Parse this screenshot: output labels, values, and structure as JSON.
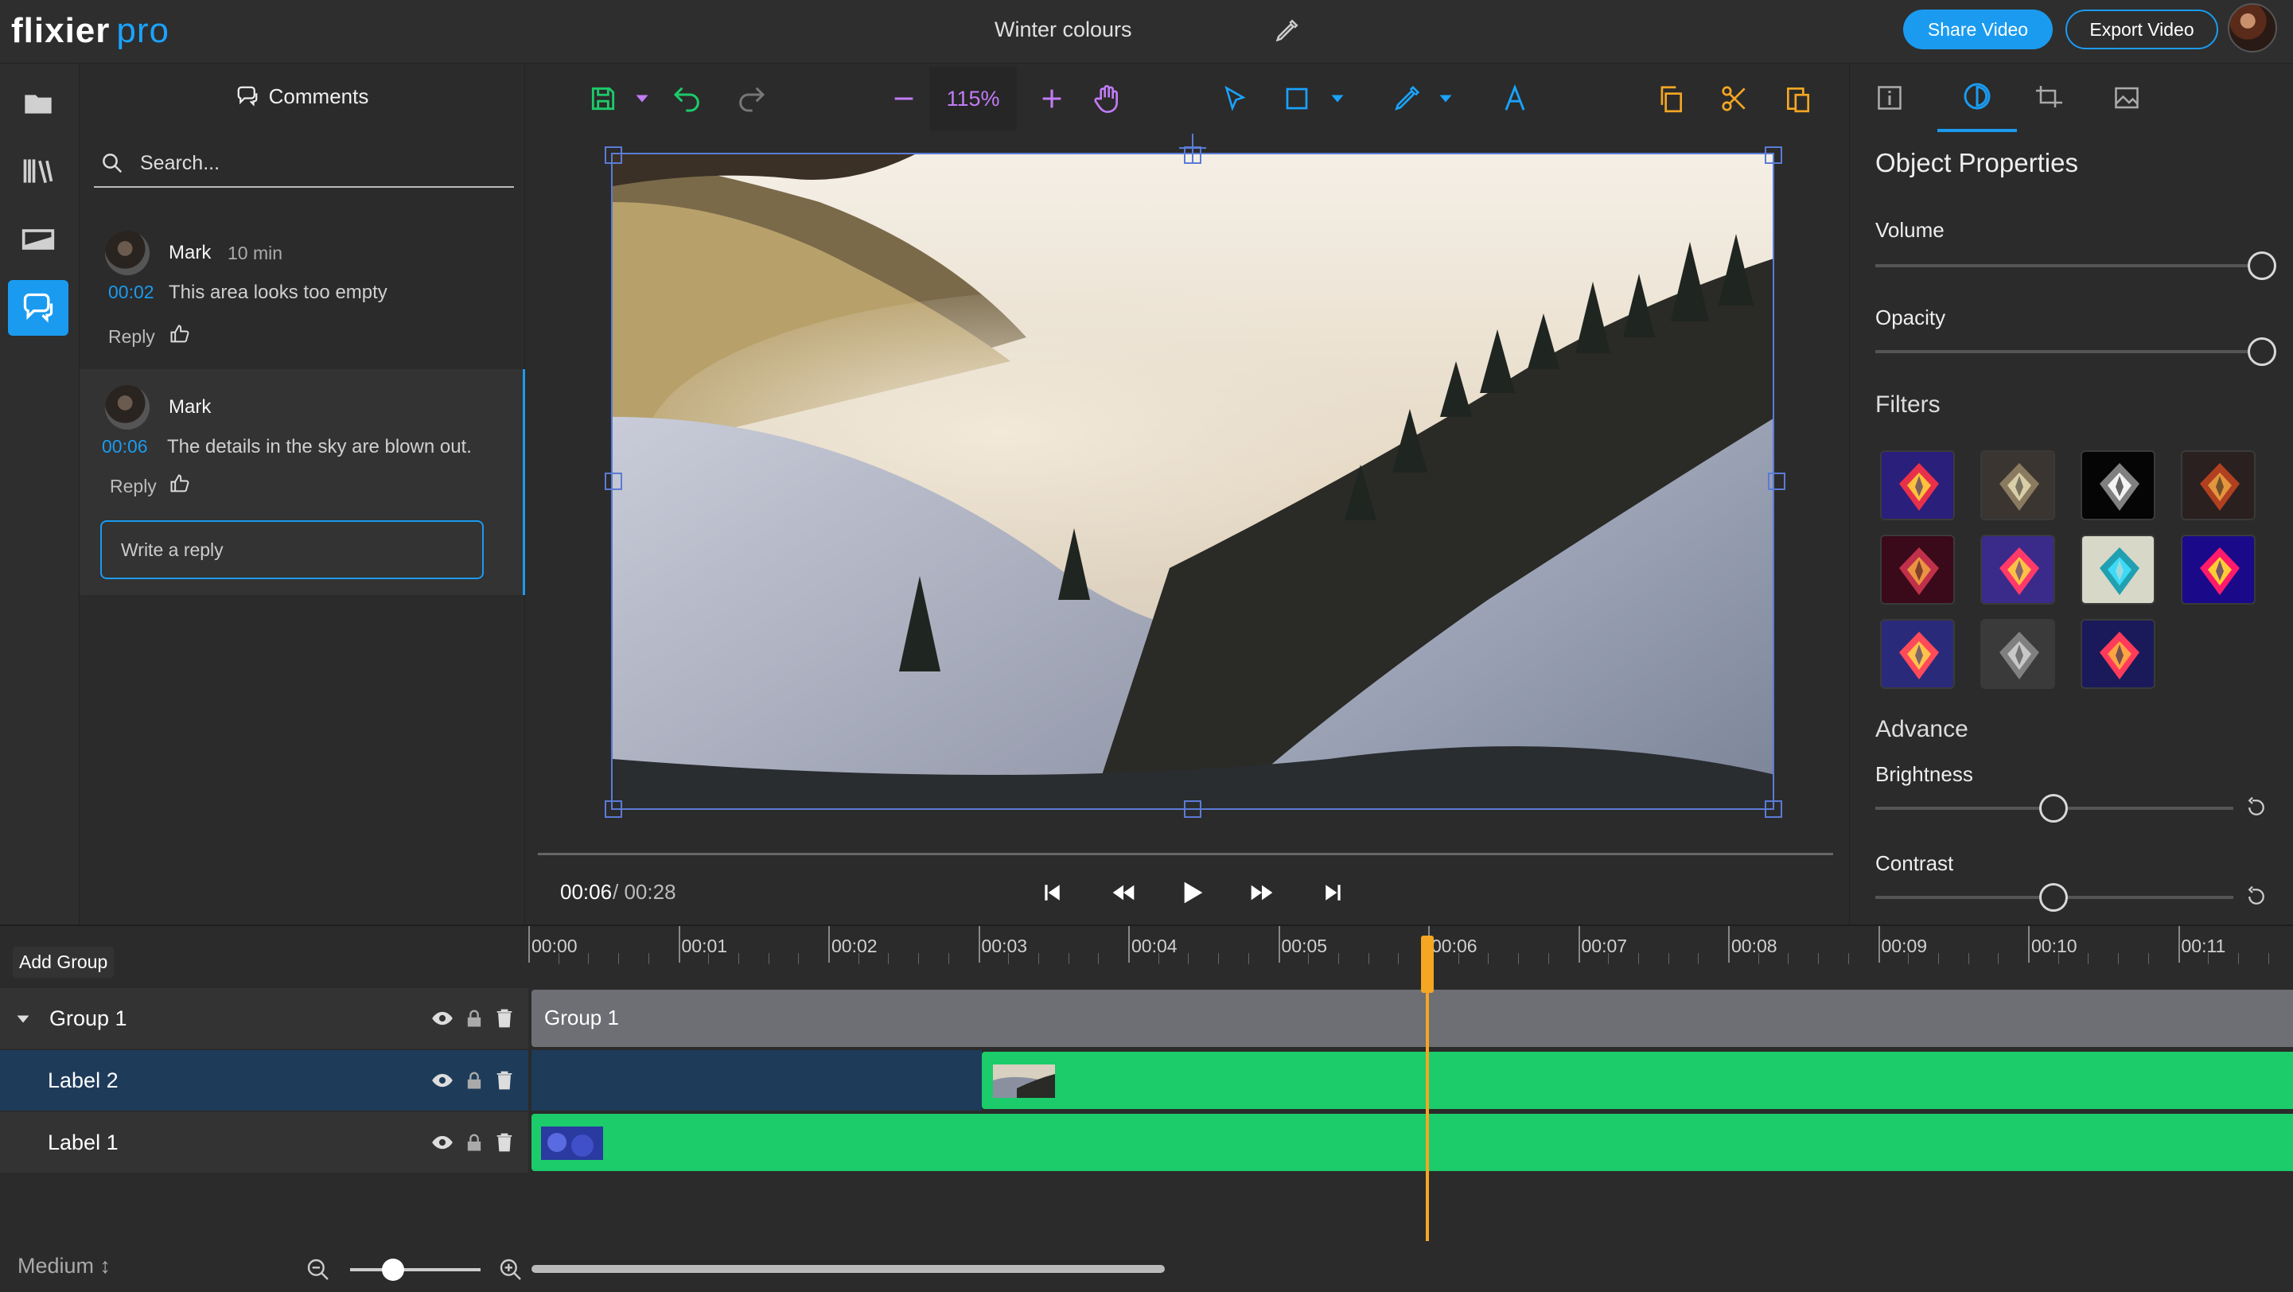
{
  "app": {
    "name": "flixier",
    "suffix": "pro",
    "title": "Winter colours"
  },
  "header": {
    "share_label": "Share Video",
    "export_label": "Export Video"
  },
  "comments": {
    "title": "Comments",
    "search_placeholder": "Search...",
    "items": [
      {
        "author": "Mark",
        "age": "10 min",
        "timestamp": "00:02",
        "text": "This area looks too empty",
        "reply_label": "Reply"
      },
      {
        "author": "Mark",
        "age": "",
        "timestamp": "00:06",
        "text": "The details in the sky are blown out.",
        "reply_label": "Reply"
      }
    ],
    "reply_placeholder": "Write a reply"
  },
  "toolbar": {
    "zoom": "115%"
  },
  "player": {
    "current": "00:06",
    "separator": "/",
    "total": "00:28",
    "progress_fraction": 0.21
  },
  "properties": {
    "title": "Object Properties",
    "volume_label": "Volume",
    "volume_value": 1.0,
    "opacity_label": "Opacity",
    "opacity_value": 1.0,
    "filters_label": "Filters",
    "filters": [
      {
        "name": "filter-1",
        "colors": [
          "#2a1f7a",
          "#e8304a",
          "#ffd23a"
        ]
      },
      {
        "name": "filter-2",
        "colors": [
          "#3a3530",
          "#8a7a60",
          "#e0d8b0"
        ]
      },
      {
        "name": "filter-3",
        "colors": [
          "#050505",
          "#808080",
          "#ffffff"
        ]
      },
      {
        "name": "filter-4",
        "colors": [
          "#2a2020",
          "#b04020",
          "#e8a040"
        ]
      },
      {
        "name": "filter-5",
        "colors": [
          "#3a0a1a",
          "#c0304a",
          "#f0a040"
        ]
      },
      {
        "name": "filter-6",
        "colors": [
          "#3a2a8a",
          "#ff3a6a",
          "#ffd040"
        ]
      },
      {
        "name": "filter-7",
        "colors": [
          "#d8d8c8",
          "#20a0b0",
          "#40e0ff"
        ]
      },
      {
        "name": "filter-8",
        "colors": [
          "#1a0a8a",
          "#ff1a6a",
          "#ffe030"
        ]
      },
      {
        "name": "filter-9",
        "colors": [
          "#2a2a7a",
          "#ff4a5a",
          "#ffd04a"
        ]
      },
      {
        "name": "filter-10",
        "colors": [
          "#3a3a3a",
          "#808080",
          "#cfcfcf"
        ]
      },
      {
        "name": "filter-11",
        "colors": [
          "#1a1a5a",
          "#ff3a5a",
          "#ffb040"
        ]
      }
    ],
    "advance_label": "Advance",
    "brightness_label": "Brightness",
    "brightness_value": 0.5,
    "contrast_label": "Contrast",
    "contrast_value": 0.5
  },
  "timeline": {
    "add_group_label": "Add Group",
    "ruler": [
      "00:00",
      "00:01",
      "00:02",
      "00:03",
      "00:04",
      "00:05",
      "00:06",
      "00:07",
      "00:08",
      "00:09",
      "00:10",
      "00:11"
    ],
    "rows": [
      {
        "name": "Group 1",
        "clip_label": "Group 1"
      },
      {
        "name": "Label 2"
      },
      {
        "name": "Label 1"
      }
    ],
    "zoom_preset": "Medium ↕",
    "playhead_time": "00:06"
  },
  "colors": {
    "accent": "#1a9bf0",
    "clip": "#1ccb6a",
    "playhead": "#f5a623",
    "zoom": "#c27cf7"
  }
}
